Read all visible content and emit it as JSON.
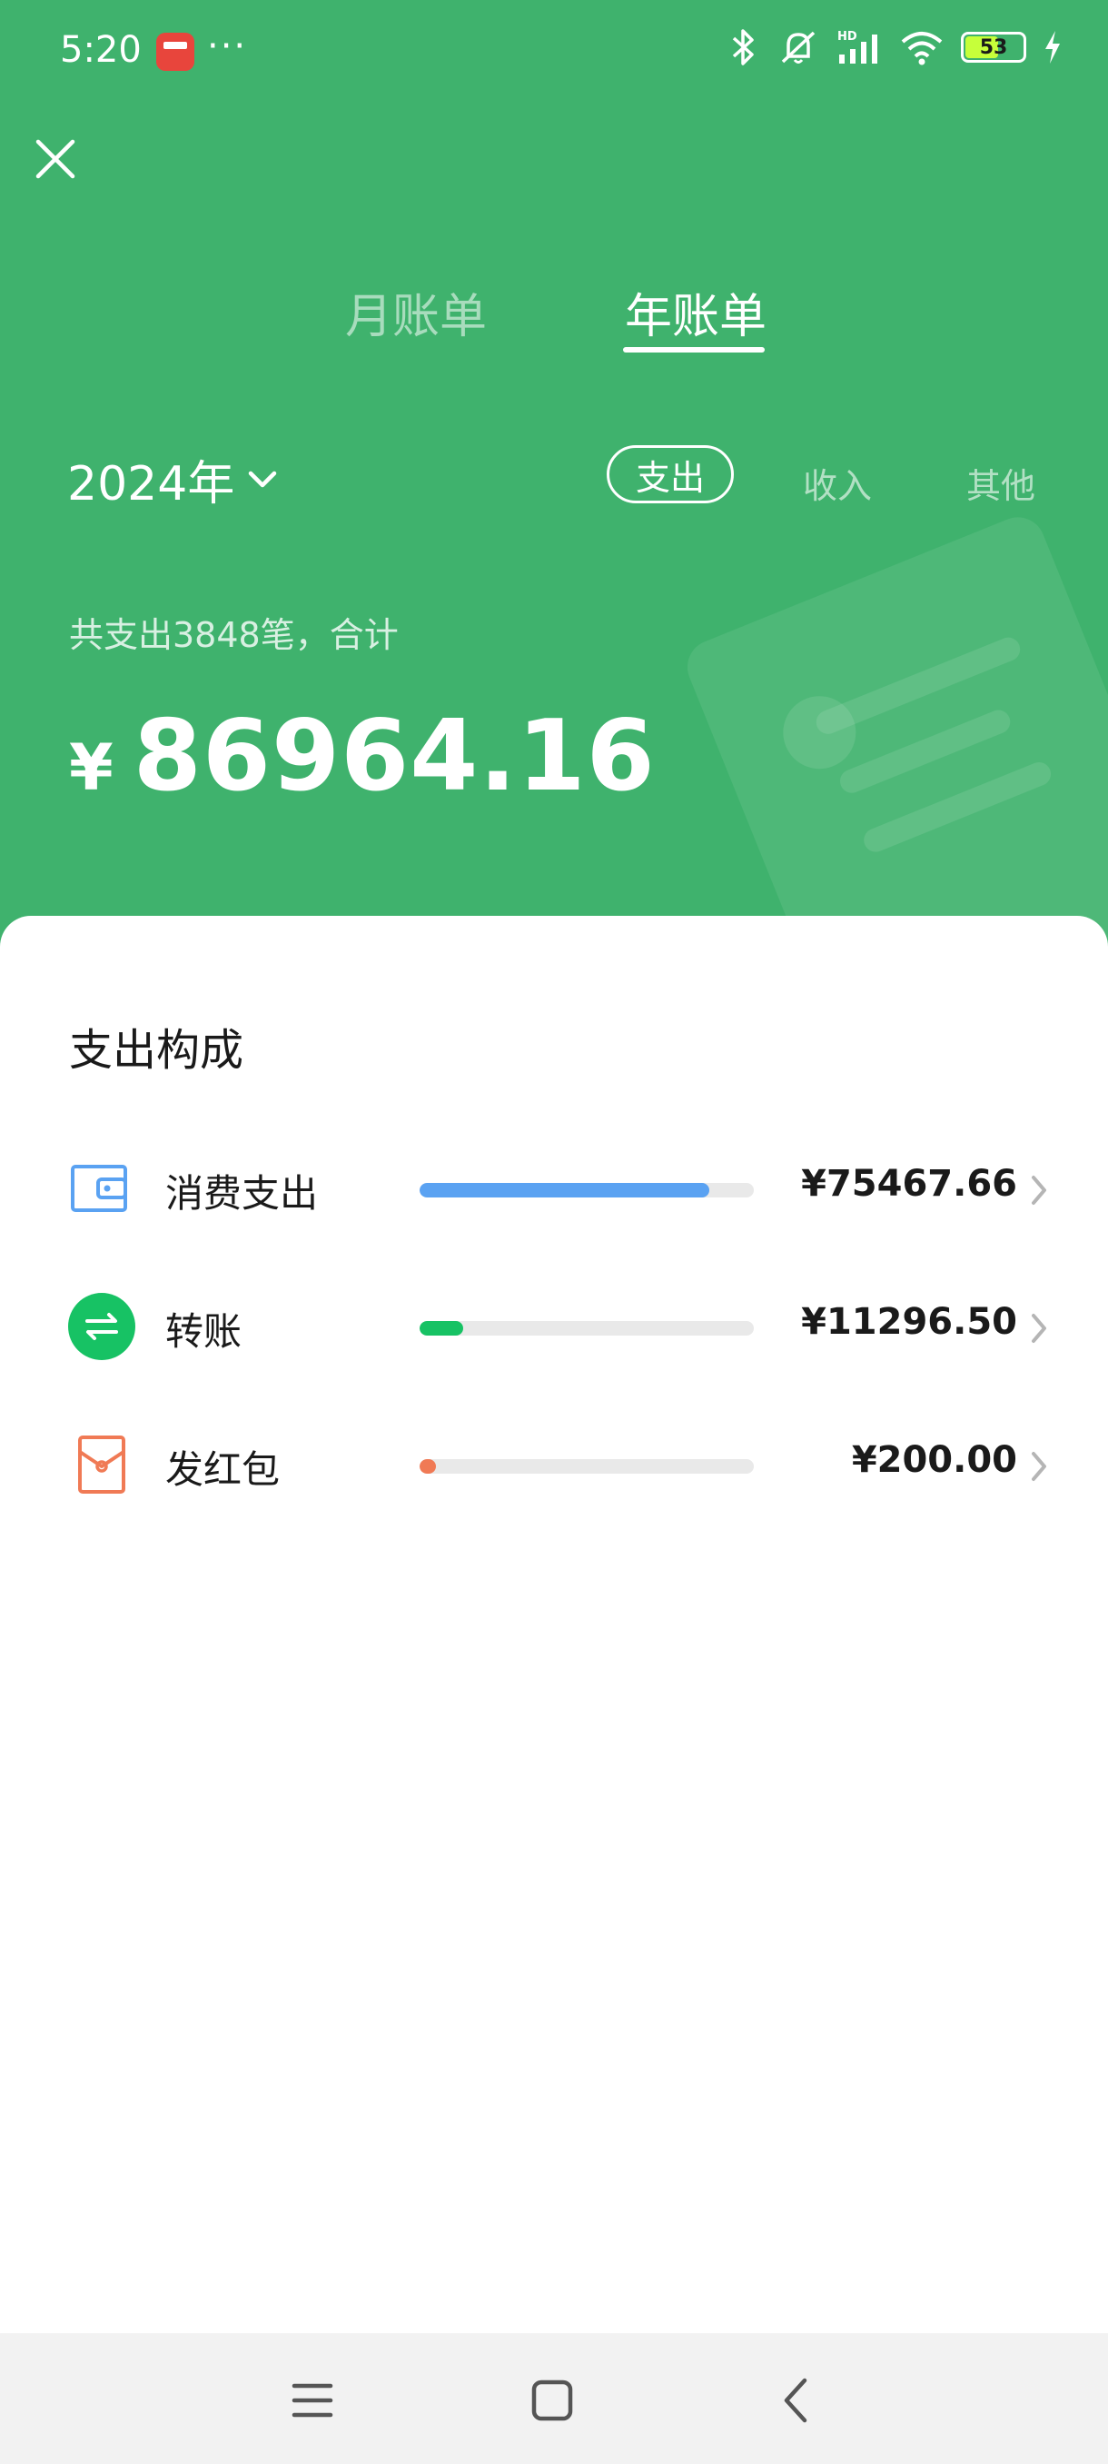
{
  "status_bar": {
    "time": "5:20",
    "more": "···",
    "battery": "53"
  },
  "tabs": {
    "month": "月账单",
    "year": "年账单",
    "active": "年账单"
  },
  "filter": {
    "year": "2024年",
    "segments": {
      "expense": "支出",
      "income": "收入",
      "other": "其他"
    },
    "active_segment": "支出"
  },
  "summary": {
    "text": "共支出3848笔，合计",
    "currency": "¥",
    "total": "86964.16"
  },
  "breakdown": {
    "title": "支出构成",
    "items": [
      {
        "label": "消费支出",
        "amount": "¥75467.66",
        "share": 0.868,
        "color": "#5aa2f2",
        "icon": "wallet-icon"
      },
      {
        "label": "转账",
        "amount": "¥11296.50",
        "share": 0.13,
        "color": "#17c264",
        "icon": "transfer-icon"
      },
      {
        "label": "发红包",
        "amount": "¥200.00",
        "share": 0.0023,
        "color": "#f07a55",
        "icon": "red-packet-icon"
      }
    ]
  },
  "colors": {
    "header_bg": "#3fb26d",
    "card_bg": "#ffffff"
  }
}
